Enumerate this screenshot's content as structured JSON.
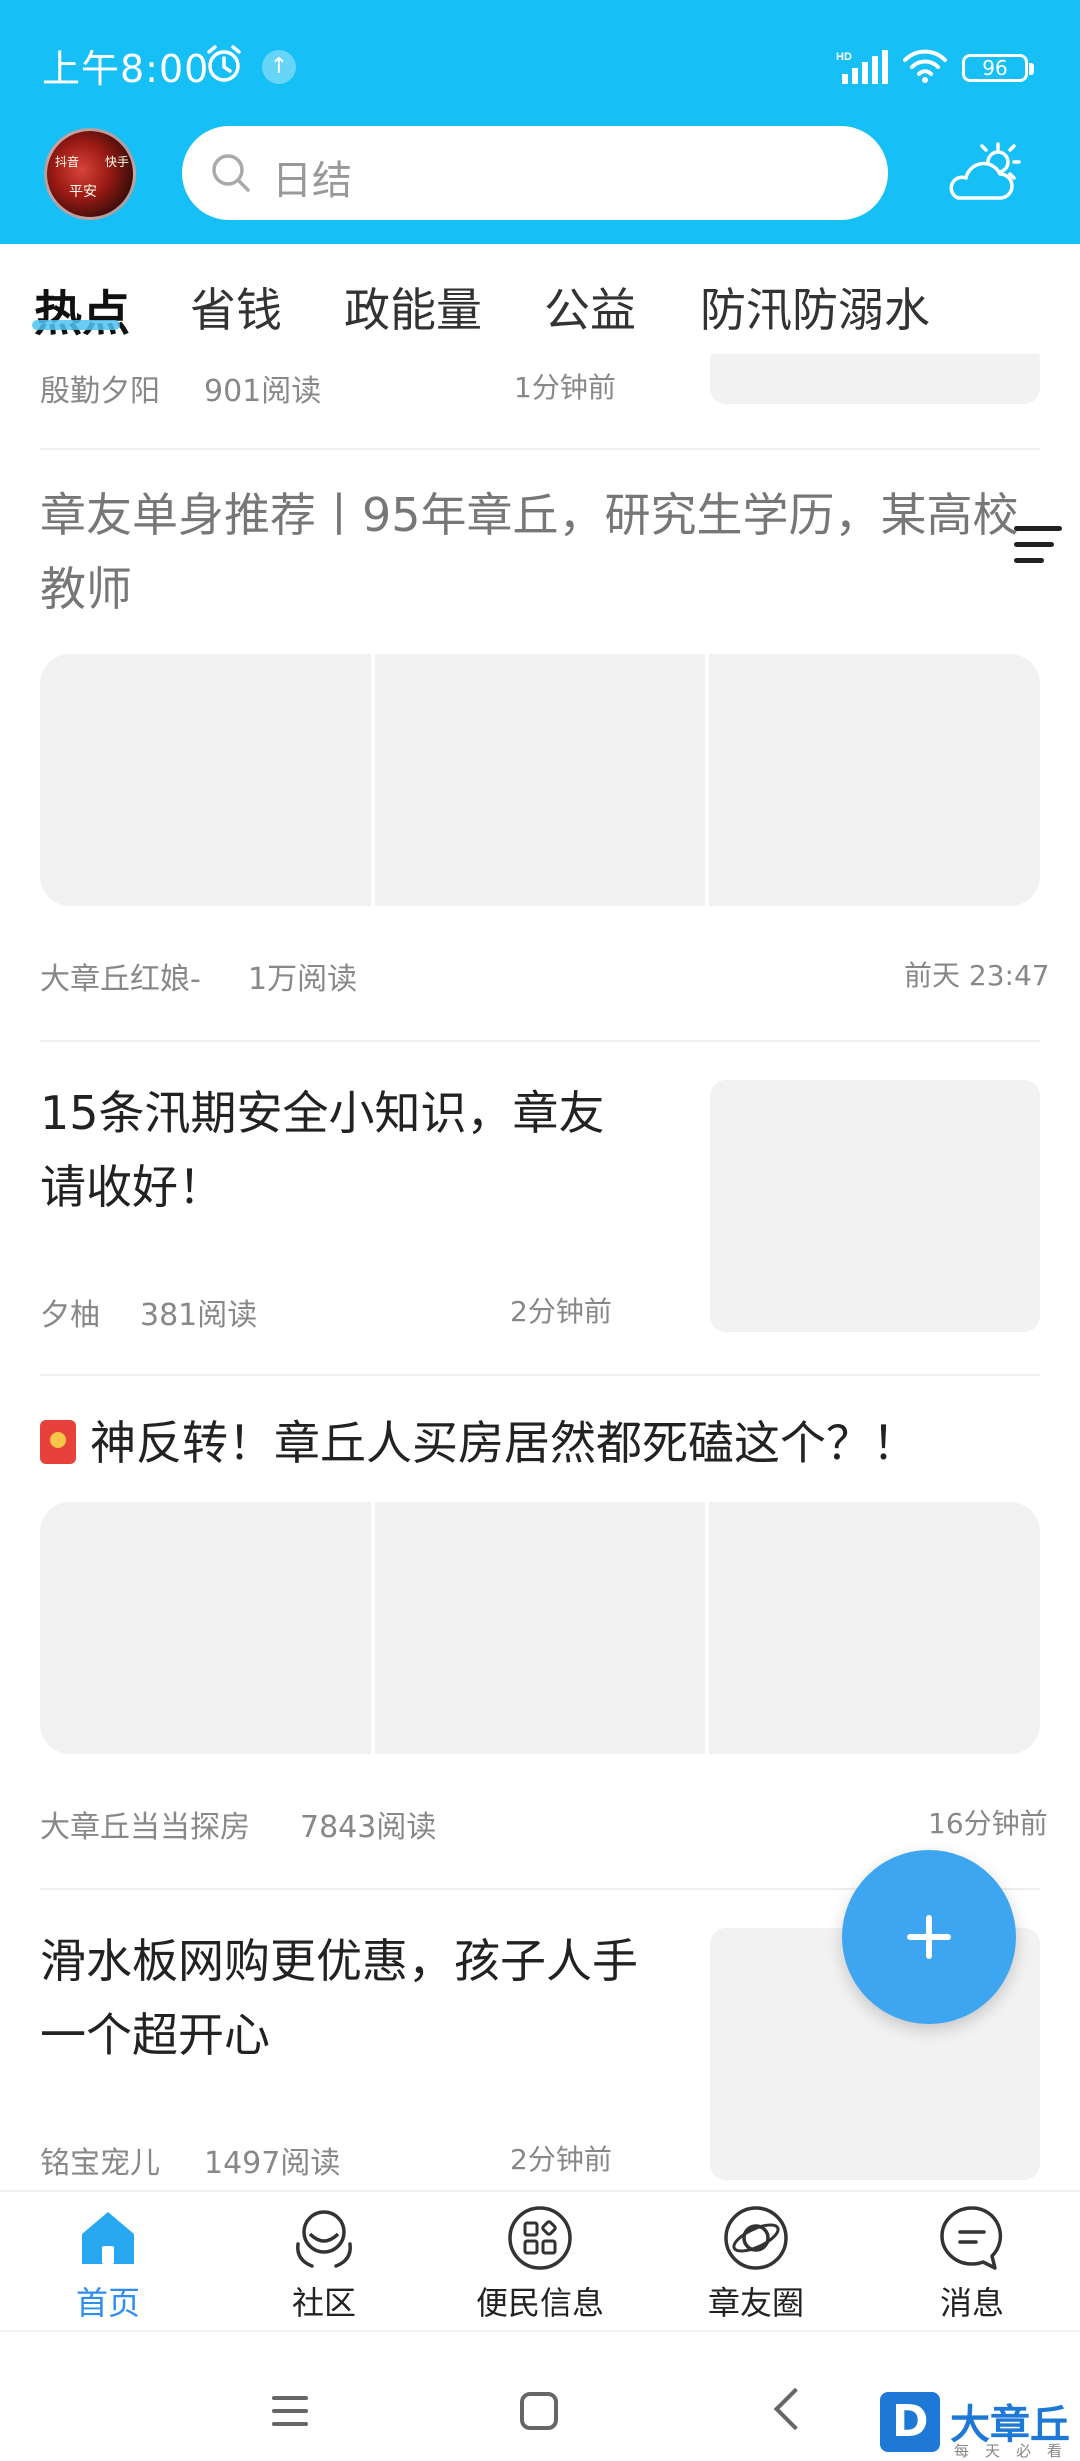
{
  "status_bar": {
    "time": "上午8:00",
    "battery": "96"
  },
  "header": {
    "search_placeholder": "日结",
    "avatar_text": [
      "抖音",
      "快手",
      "平安"
    ]
  },
  "tabs": [
    {
      "label": "热点",
      "active": true
    },
    {
      "label": "省钱"
    },
    {
      "label": "政能量"
    },
    {
      "label": "公益"
    },
    {
      "label": "防汛防溺水"
    }
  ],
  "feed": {
    "items": [
      {
        "author": "殷勤夕阳",
        "reads": "901阅读",
        "time": "1分钟前"
      },
      {
        "title": "章友单身推荐丨95年章丘，研究生学历，某高校教师",
        "author": "大章丘红娘-",
        "reads": "1万阅读",
        "time": "前天 23:47"
      },
      {
        "title": "15条汛期安全小知识，章友请收好！",
        "author": "夕柚",
        "reads": "381阅读",
        "time": "2分钟前"
      },
      {
        "title": "神反转！章丘人买房居然都死磕这个？！",
        "author": "大章丘当当探房",
        "reads": "7843阅读",
        "time": "16分钟前"
      },
      {
        "title": "滑水板网购更优惠，孩子人手一个超开心",
        "author": "铭宝宠儿",
        "reads": "1497阅读",
        "time": "2分钟前"
      }
    ]
  },
  "bottom_nav": [
    {
      "label": "首页",
      "active": true
    },
    {
      "label": "社区"
    },
    {
      "label": "便民信息"
    },
    {
      "label": "章友圈"
    },
    {
      "label": "消息"
    }
  ],
  "watermark": {
    "name": "大章丘",
    "sub": "每天必看"
  },
  "colors": {
    "header": "#16bff5",
    "accent": "#2d8ef0",
    "fab": "#3ea5f0"
  }
}
